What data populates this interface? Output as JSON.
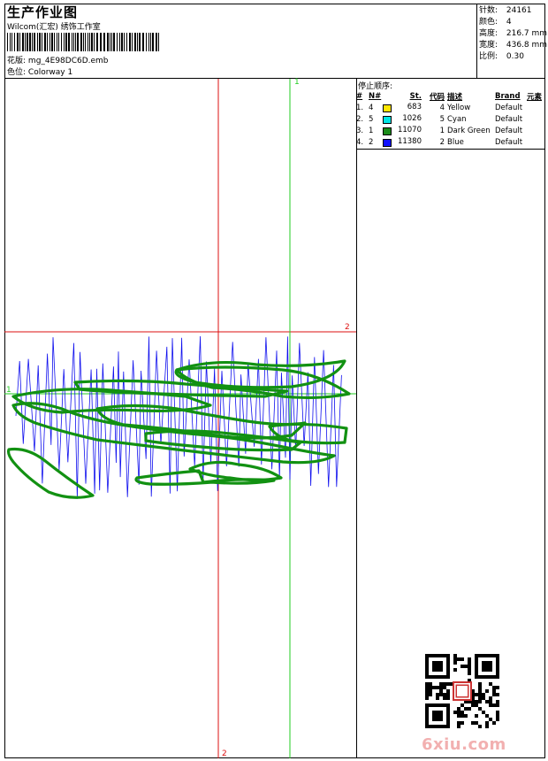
{
  "header": {
    "title": "生产作业图",
    "company": "Wilcom(汇宏) 绣饰工作室",
    "design_label": "花版:",
    "design_value": "mg_4E98DC6D.emb",
    "colorway_label": "色位:",
    "colorway_value": "Colorway 1"
  },
  "stats": [
    {
      "label": "针数:",
      "value": "24161"
    },
    {
      "label": "颜色:",
      "value": "4"
    },
    {
      "label": "高度:",
      "value": "216.7 mm"
    },
    {
      "label": "宽度:",
      "value": "436.8 mm"
    },
    {
      "label": "比例:",
      "value": "0.30"
    }
  ],
  "stop_sequence": {
    "title": "停止顺序:",
    "headers": {
      "num": "#",
      "n": "N#",
      "st": "St.",
      "code": "代码",
      "desc": "描述",
      "brand": "Brand",
      "elem": "元素"
    },
    "rows": [
      {
        "num": "1.",
        "n": "4",
        "color": "#ffe600",
        "st": "683",
        "code": "4",
        "desc": "Yellow",
        "brand": "Default"
      },
      {
        "num": "2.",
        "n": "5",
        "color": "#00e5e5",
        "st": "1026",
        "code": "5",
        "desc": "Cyan",
        "brand": "Default"
      },
      {
        "num": "3.",
        "n": "1",
        "color": "#1a8c1a",
        "st": "11070",
        "code": "1",
        "desc": "Dark Green",
        "brand": "Default"
      },
      {
        "num": "4.",
        "n": "2",
        "color": "#1010ff",
        "st": "11380",
        "code": "2",
        "desc": "Blue",
        "brand": "Default"
      }
    ]
  },
  "markers": {
    "green_top": "1",
    "green_left": "1",
    "red_right": "2",
    "red_bottom": "2"
  },
  "watermark": "6xiu.com",
  "colors": {
    "red_guide": "#d11",
    "green_guide": "#2c2",
    "green_stitch": "#129112",
    "blue_stitch": "#1010ee"
  }
}
